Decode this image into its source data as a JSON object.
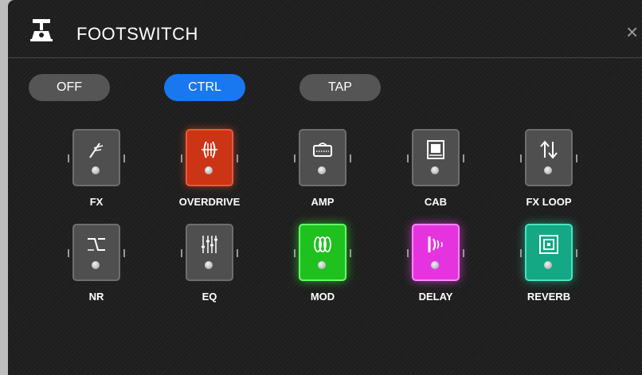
{
  "header": {
    "title": "FOOTSWITCH",
    "close_label": "×"
  },
  "modes": [
    {
      "label": "OFF",
      "active": false
    },
    {
      "label": "CTRL",
      "active": true
    },
    {
      "label": "TAP",
      "active": false
    }
  ],
  "pedals": [
    {
      "label": "FX",
      "icon": "wah-pedal-icon",
      "state": "off"
    },
    {
      "label": "OVERDRIVE",
      "icon": "overdrive-icon",
      "state": "on",
      "color": "#cc3416"
    },
    {
      "label": "AMP",
      "icon": "amp-icon",
      "state": "off"
    },
    {
      "label": "CAB",
      "icon": "cabinet-icon",
      "state": "off"
    },
    {
      "label": "FX LOOP",
      "icon": "fx-loop-icon",
      "state": "off"
    },
    {
      "label": "NR",
      "icon": "noise-reduction-icon",
      "state": "off"
    },
    {
      "label": "EQ",
      "icon": "eq-icon",
      "state": "off"
    },
    {
      "label": "MOD",
      "icon": "modulation-icon",
      "state": "on",
      "color": "#1fc11f"
    },
    {
      "label": "DELAY",
      "icon": "delay-icon",
      "state": "on",
      "color": "#e534df"
    },
    {
      "label": "REVERB",
      "icon": "reverb-icon",
      "state": "on",
      "color": "#14a885"
    }
  ],
  "colors": {
    "accent": "#1977f0",
    "panel_bg": "#1e1e1e",
    "button_bg": "#555555"
  }
}
